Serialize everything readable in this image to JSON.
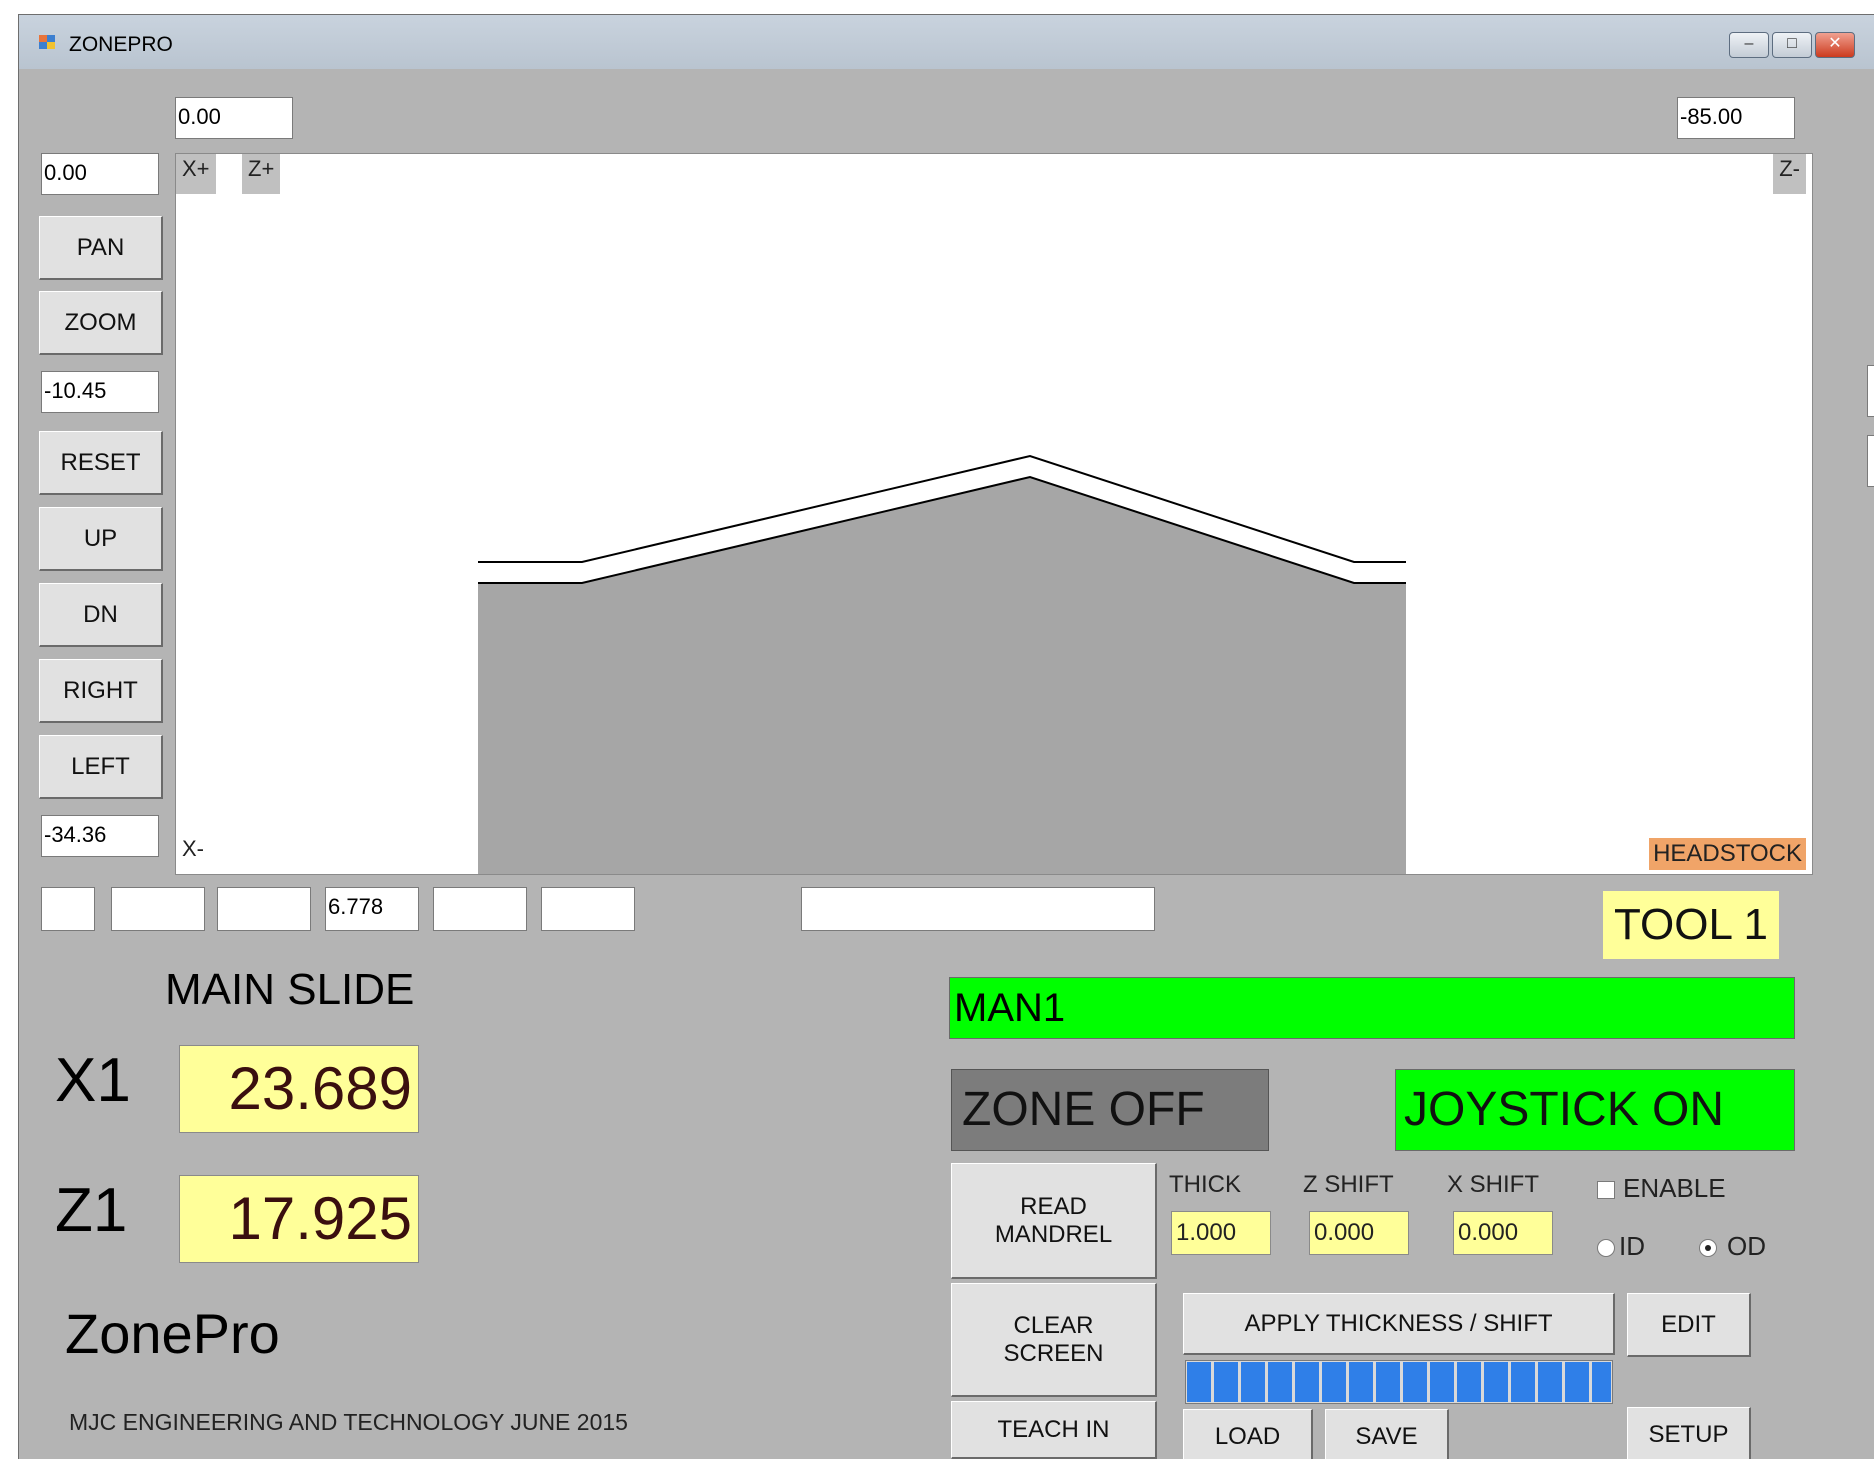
{
  "window": {
    "title": "ZONEPRO",
    "controls": [
      "minimize",
      "maximize",
      "close"
    ]
  },
  "view": {
    "top_left_value": "0.00",
    "top_right_value": "-85.00",
    "left_top_value": "0.00",
    "zoom_value": "-10.45",
    "left_bottom_value": "-34.36",
    "axis_xplus": "X+",
    "axis_zplus": "Z+",
    "axis_zminus": "Z-",
    "axis_xminus": "X-",
    "headstock_label": "HEADSTOCK"
  },
  "nav_buttons": {
    "pan": "PAN",
    "zoom": "ZOOM",
    "reset": "RESET",
    "up": "UP",
    "dn": "DN",
    "right": "RIGHT",
    "left": "LEFT"
  },
  "bottom_fields": [
    "",
    "",
    "",
    "6.778",
    "",
    ""
  ],
  "message_field": "",
  "tool_label": "TOOL 1",
  "main_slide": {
    "title": "MAIN SLIDE",
    "x_label": "X1",
    "x_value": "23.689",
    "z_label": "Z1",
    "z_value": "17.925"
  },
  "app_name": "ZonePro",
  "footer": "MJC ENGINEERING AND TECHNOLOGY JUNE 2015",
  "program_name": "MAN1",
  "zone_status": "ZONE OFF",
  "joystick_status": "JOYSTICK ON",
  "buttons": {
    "read_mandrel": "READ\nMANDREL",
    "clear_screen": "CLEAR\nSCREEN",
    "teach_in": "TEACH IN",
    "apply": "APPLY THICKNESS / SHIFT",
    "edit": "EDIT",
    "load": "LOAD",
    "save": "SAVE",
    "setup": "SETUP"
  },
  "params": {
    "thick_label": "THICK",
    "thick_value": "1.000",
    "zshift_label": "Z SHIFT",
    "zshift_value": "0.000",
    "xshift_label": "X SHIFT",
    "xshift_value": "0.000",
    "enable_label": "ENABLE",
    "enable_checked": false,
    "id_label": "ID",
    "od_label": "OD",
    "selected": "OD"
  },
  "progress": 1.0,
  "colors": {
    "window_bg": "#b4b4b4",
    "green": "#00ff00",
    "zone_off": "#7c7c7c",
    "yellow": "#ffff99",
    "headstock": "#f0a468",
    "progress_blue": "#2f7fe8"
  }
}
